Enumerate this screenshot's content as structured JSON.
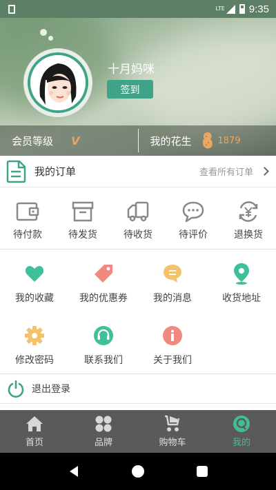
{
  "status_bar": {
    "time": "9:35",
    "network": "LTE"
  },
  "profile": {
    "username": "十月妈咪",
    "signin_label": "签到"
  },
  "info_bar": {
    "member_level_label": "会员等级",
    "member_level_value": "V",
    "peanut_label": "我的花生",
    "peanut_count": "1879"
  },
  "orders": {
    "title": "我的订单",
    "view_all": "查看所有订单"
  },
  "order_statuses": [
    {
      "label": "待付款",
      "icon": "wallet-icon"
    },
    {
      "label": "待发货",
      "icon": "box-icon"
    },
    {
      "label": "待收货",
      "icon": "truck-icon"
    },
    {
      "label": "待评价",
      "icon": "chat-bubble-icon"
    },
    {
      "label": "退换货",
      "icon": "yuan-refresh-icon"
    }
  ],
  "features": [
    {
      "label": "我的收藏",
      "icon": "heart-icon",
      "color": "#3fbf9a"
    },
    {
      "label": "我的优惠券",
      "icon": "tag-icon",
      "color": "#f08a7e"
    },
    {
      "label": "我的消息",
      "icon": "message-icon",
      "color": "#f5c26b"
    },
    {
      "label": "收货地址",
      "icon": "location-pin-icon",
      "color": "#3fbf9a"
    },
    {
      "label": "修改密码",
      "icon": "gear-icon",
      "color": "#f5c26b"
    },
    {
      "label": "联系我们",
      "icon": "headset-icon",
      "color": "#3fbf9a"
    },
    {
      "label": "关于我们",
      "icon": "info-icon",
      "color": "#f08a7e"
    }
  ],
  "logout": {
    "label": "退出登录"
  },
  "tabs": [
    {
      "label": "首页",
      "icon": "home-icon",
      "active": false
    },
    {
      "label": "品牌",
      "icon": "grid-icon",
      "active": false
    },
    {
      "label": "购物车",
      "icon": "stroller-icon",
      "active": false
    },
    {
      "label": "我的",
      "icon": "profile-icon",
      "active": true
    }
  ],
  "colors": {
    "accent": "#3fa487",
    "tab_active": "#3fbf8f",
    "gold": "#e8a764"
  }
}
